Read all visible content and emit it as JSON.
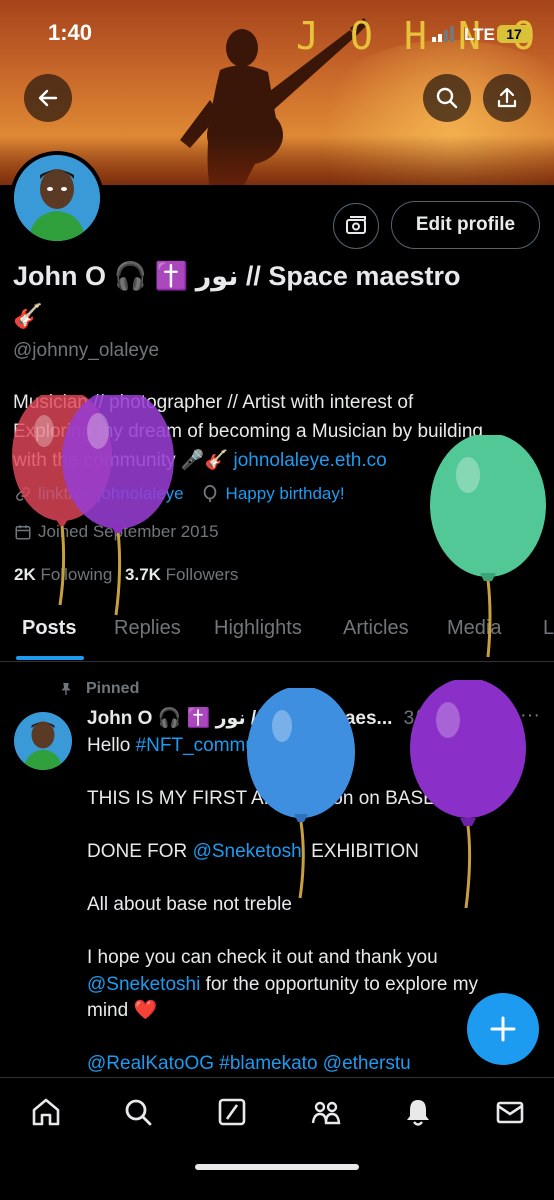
{
  "status_bar": {
    "time": "1:40",
    "network": "LTE",
    "battery": "17"
  },
  "banner": {
    "letters": [
      "J",
      "O",
      "H",
      "N",
      "O"
    ]
  },
  "header": {
    "back_icon": "back-arrow-icon",
    "search_icon": "search-icon",
    "share_icon": "share-icon"
  },
  "profile": {
    "display_name": "John O 🎧 ✝️ نور // Space maestro",
    "name_line2": "🎸",
    "handle": "@johnny_olaleye",
    "bio_line1": "Musician // photographer // Artist with interest of",
    "bio_line2": "Exploring my dream of becoming a Musician by building",
    "bio_line3_text": "with the community 🎤🎸 ",
    "bio_link": "johnolaleye.eth.co",
    "website": "linktree/johnolaleye",
    "birthday": "Happy birthday!",
    "joined": "Joined September 2015",
    "following_count": "2K",
    "following_label": "Following",
    "followers_count": "3.7K",
    "followers_label": "Followers",
    "edit_profile_label": "Edit profile"
  },
  "tabs": [
    {
      "label": "Posts",
      "active": true
    },
    {
      "label": "Replies"
    },
    {
      "label": "Highlights"
    },
    {
      "label": "Articles"
    },
    {
      "label": "Media"
    },
    {
      "label": "L"
    }
  ],
  "pinned_post": {
    "pinned_label": "Pinned",
    "author": "John O 🎧 ✝️ نور // Space maes...",
    "date": "3/31/24",
    "line1_text": "Hello ",
    "line1_tag": "#NFT_community",
    "line2": "THIS IS MY FIRST AI collection on BASE",
    "line3_text": "DONE FOR ",
    "line3_mention": "@Sneketoshi",
    "line3_end": " EXHIBITION",
    "line4": "All about base not treble",
    "line5": "I hope you can check it out and thank you",
    "line6_mention": "@Sneketoshi",
    "line6_text": " for the opportunity to explore my",
    "line7": "mind ❤️",
    "line8": "@RealKatoOG #blamekato @etherstu"
  },
  "bottom_nav": [
    "home-icon",
    "search-icon",
    "grok-icon",
    "communities-icon",
    "notifications-icon",
    "messages-icon"
  ],
  "colors": {
    "accent": "#1d9bf0",
    "muted": "#71767b",
    "text": "#e7e9ea",
    "background": "#000000"
  }
}
